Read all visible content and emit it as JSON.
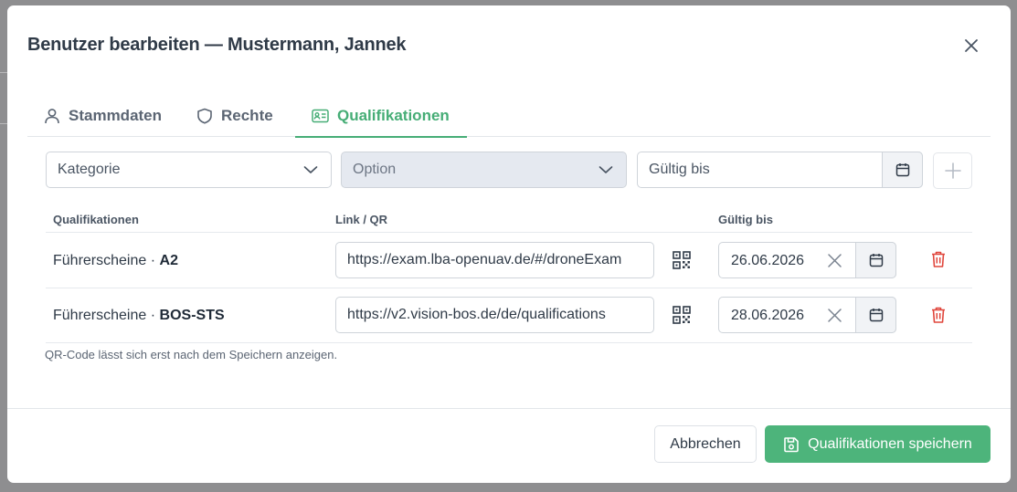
{
  "dialog": {
    "title": "Benutzer bearbeiten — Mustermann, Jannek"
  },
  "tabs": [
    {
      "label": "Stammdaten",
      "icon": "user-icon",
      "active": false
    },
    {
      "label": "Rechte",
      "icon": "shield-icon",
      "active": false
    },
    {
      "label": "Qualifikationen",
      "icon": "id-card-icon",
      "active": true
    }
  ],
  "filters": {
    "category_placeholder": "Kategorie",
    "option_placeholder": "Option",
    "valid_until_placeholder": "Gültig bis"
  },
  "table": {
    "headers": [
      "Qualifikationen",
      "Link / QR",
      "Gültig bis"
    ],
    "rows": [
      {
        "category": "Führerscheine",
        "separator": "·",
        "name": "A2",
        "link": "https://exam.lba-openuav.de/#/droneExam",
        "valid_until": "26.06.2026"
      },
      {
        "category": "Führerscheine",
        "separator": "·",
        "name": "BOS-STS",
        "link": "https://v2.vision-bos.de/de/qualifications",
        "valid_until": "28.06.2026"
      }
    ]
  },
  "hint": "QR-Code lässt sich erst nach dem Speichern anzeigen.",
  "footer": {
    "cancel_label": "Abbrechen",
    "save_label": "Qualifikationen speichern"
  },
  "colors": {
    "accent": "#46ad76",
    "save_button": "#4db47b",
    "delete": "#e0463c"
  }
}
